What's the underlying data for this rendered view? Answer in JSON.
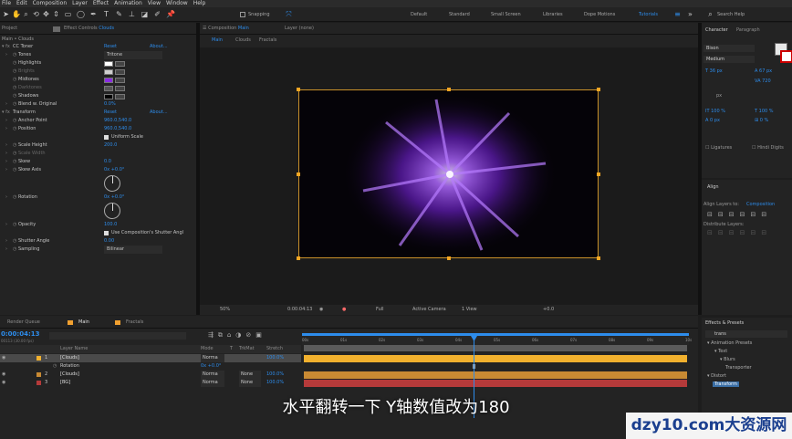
{
  "menu": [
    "File",
    "Edit",
    "Composition",
    "Layer",
    "Effect",
    "Animation",
    "View",
    "Window",
    "Help"
  ],
  "toolbar": {
    "snapping_label": "Snapping",
    "workspaces": [
      "Default",
      "Standard",
      "Small Screen",
      "Libraries",
      "Dope Motions",
      "Tutorials"
    ],
    "active_workspace": "Tutorials",
    "search_placeholder": "Search Help"
  },
  "project_panel": {
    "tab_project": "Project",
    "tab_effect_controls": "Effect Controls",
    "effect_controls_target": "Clouds",
    "subtitle": "Main • Clouds"
  },
  "effects": [
    {
      "type": "header",
      "label": "CC Toner",
      "reset": "Reset",
      "about": "About..."
    },
    {
      "type": "prop",
      "label": "Tones",
      "value": "Tritone",
      "dropdown": true
    },
    {
      "type": "color",
      "label": "Highlights",
      "color": "#ffffff"
    },
    {
      "type": "color",
      "label": "Brights",
      "color": "#cfcfcf",
      "dim": true
    },
    {
      "type": "color",
      "label": "Midtones",
      "color": "#8a2be2"
    },
    {
      "type": "color",
      "label": "Darktones",
      "color": "#555555",
      "dim": true
    },
    {
      "type": "color",
      "label": "Shadows",
      "color": "#000000"
    },
    {
      "type": "prop",
      "label": "Blend w. Original",
      "value": "0.0%"
    },
    {
      "type": "header",
      "label": "Transform",
      "reset": "Reset",
      "about": "About..."
    },
    {
      "type": "prop",
      "label": "Anchor Point",
      "value": "960.0,540.0"
    },
    {
      "type": "prop",
      "label": "Position",
      "value": "960.0,540.0"
    },
    {
      "type": "check",
      "label": "",
      "value": "Uniform Scale"
    },
    {
      "type": "prop",
      "label": "Scale Height",
      "value": "200.0"
    },
    {
      "type": "prop",
      "label": "Scale Width",
      "value": "",
      "dim": true
    },
    {
      "type": "prop",
      "label": "Skew",
      "value": "0.0"
    },
    {
      "type": "prop",
      "label": "Skew Axis",
      "value": "0x +0.0°"
    },
    {
      "type": "prop",
      "label": "Rotation",
      "value": "0x +0.0°"
    },
    {
      "type": "prop",
      "label": "Opacity",
      "value": "100.0"
    },
    {
      "type": "check",
      "label": "",
      "value": "Use Composition's Shutter Angl"
    },
    {
      "type": "prop",
      "label": "Shutter Angle",
      "value": "0.00"
    },
    {
      "type": "prop",
      "label": "Sampling",
      "value": "Bilinear",
      "dropdown": true
    }
  ],
  "composition": {
    "tab_label": "Composition",
    "comp_name": "Main",
    "layer_tab": "Layer (none)",
    "breadcrumbs": [
      "Main",
      "Clouds",
      "Fractals"
    ],
    "zoom": "50%",
    "timecode": "0:00:04:13",
    "resolution": "Full",
    "camera": "Active Camera",
    "views": "1 View",
    "exposure": "+0.0"
  },
  "character_panel": {
    "tab_character": "Character",
    "tab_paragraph": "Paragraph",
    "font": "Bison",
    "style": "Medium",
    "font_size": "36 px",
    "leading": "67 px",
    "tracking": "720",
    "stroke_px": "px",
    "vscale": "100 %",
    "hscale": "100 %",
    "baseline": "0 px",
    "tsume": "0 %",
    "ligatures": "Ligatures",
    "hindi_digits": "Hindi Digits"
  },
  "align_panel": {
    "title": "Align",
    "align_to_label": "Align Layers to:",
    "align_to_value": "Composition",
    "distribute_label": "Distribute Layers:"
  },
  "effects_presets": {
    "title": "Effects & Presets",
    "search": "trans",
    "tree": [
      "▾ Animation Presets",
      "▾ Text",
      "▾ Blurs",
      "Transporter",
      "▾ Distort",
      "Transform"
    ]
  },
  "timeline": {
    "tab_render_queue": "Render Queue",
    "tab_main": "Main",
    "tab_fractals": "Fractals",
    "timecode": "0:00:04:13",
    "fps": "00113 (30.00 fps)",
    "columns": {
      "layer_name": "Layer Name",
      "mode": "Mode",
      "t": "T",
      "trkmat": "TrkMat",
      "stretch": "Stretch"
    },
    "layers": [
      {
        "num": "1",
        "name": "[Clouds]",
        "mode": "Norma",
        "stretch": "100.0%",
        "color": "#f2b12e",
        "selected": true
      },
      {
        "num": "",
        "name": "Rotation",
        "mode": "",
        "stretch": "",
        "rotation_value": "0x +0.0°",
        "sub": true
      },
      {
        "num": "2",
        "name": "[Clouds]",
        "mode": "Norma",
        "trkmat": "None",
        "stretch": "100.0%",
        "color": "#c98a33"
      },
      {
        "num": "3",
        "name": "[BG]",
        "mode": "Norma",
        "trkmat": "None",
        "stretch": "100.0%",
        "color": "#b53a3a"
      }
    ],
    "ruler": [
      "00s",
      "01s",
      "02s",
      "03s",
      "04s",
      "05s",
      "06s",
      "07s",
      "08s",
      "09s",
      "10s"
    ]
  },
  "subtitle": "水平翻转一下 Y轴数值改为180",
  "watermark": "dzy10.com大资源网"
}
